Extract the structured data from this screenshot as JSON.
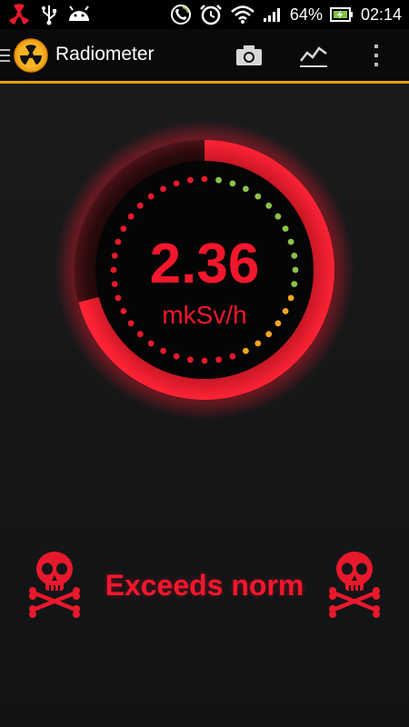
{
  "status_bar": {
    "battery_percent": "64%",
    "time": "02:14",
    "icons": [
      "radiation-icon",
      "usb-icon",
      "android-icon",
      "phone-signal-icon",
      "alarm-icon",
      "wifi-icon",
      "cell-signal-icon",
      "battery-charging-icon"
    ]
  },
  "action_bar": {
    "title": "Radiometer",
    "icons": [
      "menu-icon",
      "radiation-logo-icon",
      "camera-icon",
      "chart-icon",
      "overflow-menu-icon"
    ]
  },
  "meter": {
    "value": "2.36",
    "unit": "mkSv/h",
    "progress_fraction": 0.71,
    "colors": {
      "accent": "#f2172c",
      "dot_green": "#8bc34a",
      "dot_orange": "#f5a623",
      "dot_red": "#e8192c"
    }
  },
  "status": {
    "label": "Exceeds norm",
    "icons": [
      "skull-crossbones-icon",
      "skull-crossbones-icon"
    ]
  }
}
